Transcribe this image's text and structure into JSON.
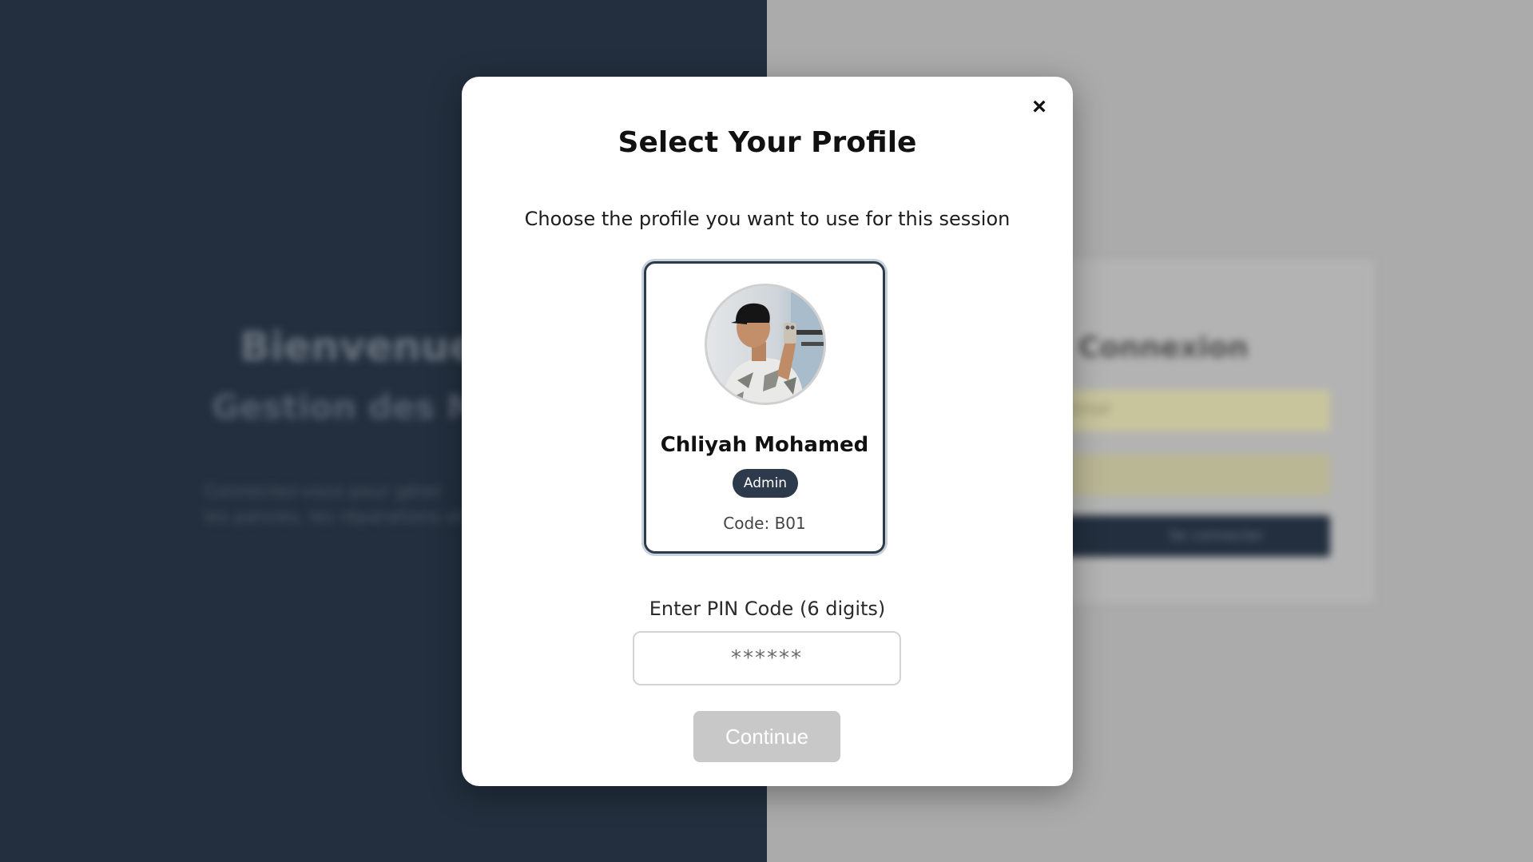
{
  "background": {
    "welcome_title": "Bienvenue",
    "welcome_subtitle": "Gestion des Ma",
    "welcome_text_line1": "Connectez-vous pour gérer",
    "welcome_text_line2": "les pannes, les réparations et",
    "login_title": "Connexion",
    "login_field_placeholder": "Email",
    "login_button": "Se connecter"
  },
  "modal": {
    "close_label": "×",
    "title": "Select Your Profile",
    "subtitle": "Choose the profile you want to use for this session",
    "profile": {
      "name": "Chliyah Mohamed",
      "role": "Admin",
      "code": "Code: B01"
    },
    "pin": {
      "label": "Enter PIN Code (6 digits)",
      "placeholder": "******",
      "value": ""
    },
    "continue_label": "Continue"
  },
  "colors": {
    "left_panel": "#232f3e",
    "right_panel": "#ababab",
    "badge": "#2c3a4c",
    "continue_disabled": "#c8c8c8"
  }
}
